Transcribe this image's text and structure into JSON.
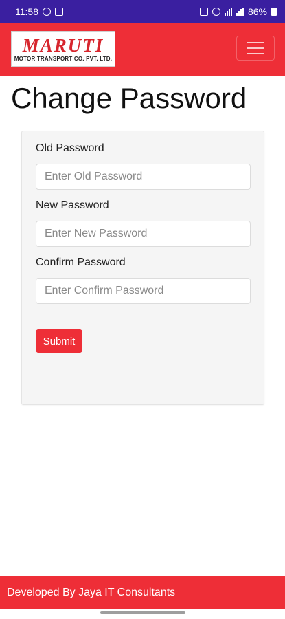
{
  "status_bar": {
    "time": "11:58",
    "battery": "86%"
  },
  "navbar": {
    "logo_main": "MARUTI",
    "logo_sub": "MOTOR TRANSPORT CO. PVT. LTD."
  },
  "page": {
    "title": "Change Password"
  },
  "form": {
    "old_password": {
      "label": "Old Password",
      "placeholder": "Enter Old Password",
      "value": ""
    },
    "new_password": {
      "label": "New Password",
      "placeholder": "Enter New Password",
      "value": ""
    },
    "confirm_password": {
      "label": "Confirm Password",
      "placeholder": "Enter Confirm Password",
      "value": ""
    },
    "submit_label": "Submit"
  },
  "footer": {
    "text": "Developed By Jaya IT Consultants"
  },
  "colors": {
    "status_bar": "#3a1fa0",
    "brand_red": "#ee2e37",
    "card_bg": "#f5f5f5"
  }
}
